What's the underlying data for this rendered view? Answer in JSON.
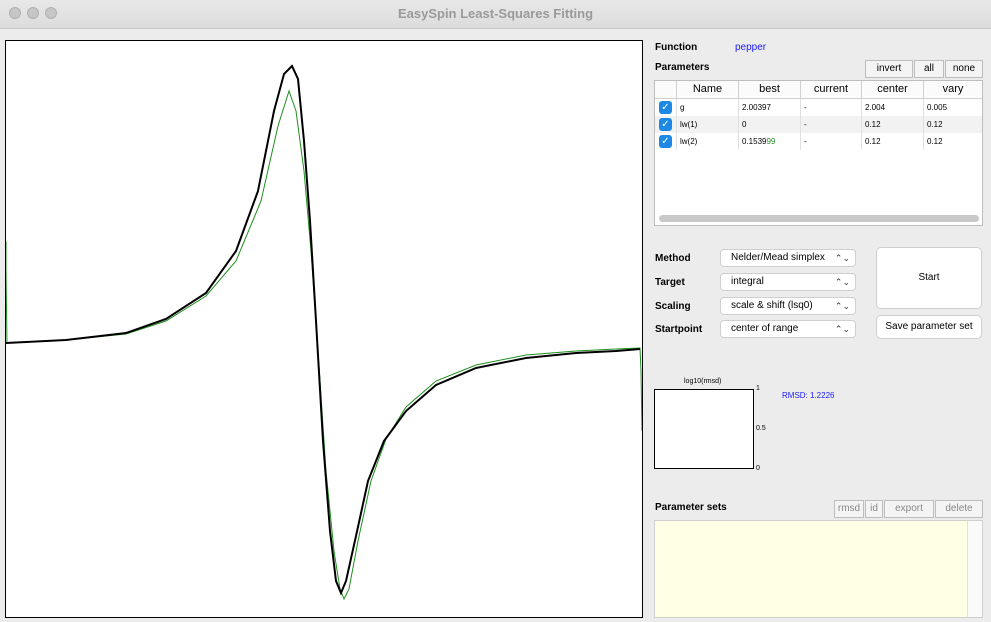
{
  "window": {
    "title": "EasySpin Least-Squares Fitting"
  },
  "function": {
    "label": "Function",
    "value": "pepper"
  },
  "parameters": {
    "label": "Parameters",
    "buttons": {
      "invert": "invert",
      "all": "all",
      "none": "none"
    },
    "columns": [
      "Name",
      "best",
      "current",
      "center",
      "vary"
    ],
    "rows": [
      {
        "checked": true,
        "name": "g",
        "best": "2.00397",
        "best_suffix": "",
        "current": "-",
        "center": "2.004",
        "vary": "0.005"
      },
      {
        "checked": true,
        "name": "lw(1)",
        "best": "0",
        "best_suffix": "",
        "current": "-",
        "center": "0.12",
        "vary": "0.12"
      },
      {
        "checked": true,
        "name": "lw(2)",
        "best": "0.1539",
        "best_suffix": "99",
        "current": "-",
        "center": "0.12",
        "vary": "0.12"
      }
    ]
  },
  "settings": {
    "method": {
      "label": "Method",
      "value": "Nelder/Mead simplex"
    },
    "target": {
      "label": "Target",
      "value": "integral"
    },
    "scaling": {
      "label": "Scaling",
      "value": "scale & shift (lsq0)"
    },
    "startpoint": {
      "label": "Startpoint",
      "value": "center of range"
    }
  },
  "actions": {
    "start": "Start",
    "save": "Save parameter set"
  },
  "rmsd_plot": {
    "title": "log10(rmsd)",
    "ticks": [
      "1",
      "0.5",
      "0"
    ],
    "rmsd_text": "RMSD: 1.2226"
  },
  "parameter_sets": {
    "label": "Parameter sets",
    "buttons": {
      "rmsd": "rmsd",
      "id": "id",
      "export": "export",
      "delete": "delete"
    }
  },
  "colors": {
    "data": "#000000",
    "fit": "#1f8f1f",
    "accent": "#1a1aff",
    "checkbox": "#1e88e5"
  }
}
